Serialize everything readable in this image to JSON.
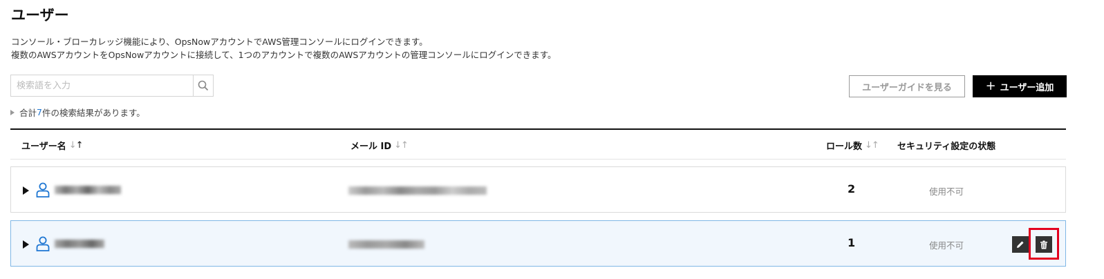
{
  "page": {
    "title": "ユーザー",
    "description": [
      "コンソール・ブローカレッジ機能により、OpsNowアカウントでAWS管理コンソールにログインできます。",
      "複数のAWSアカウントをOpsNowアカウントに接続して、1つのアカウントで複数のAWSアカウントの管理コンソールにログインできます。"
    ]
  },
  "search": {
    "placeholder": "検索語を入力",
    "value": ""
  },
  "summary": {
    "prefix": "合計",
    "count": "7",
    "suffix": "件の検索結果があります。"
  },
  "buttons": {
    "guide": "ユーザーガイドを見る",
    "add": "ユーザー追加"
  },
  "table": {
    "columns": {
      "username": "ユーザー名",
      "email": "メール ID",
      "roles": "ロール数",
      "security": "セキュリティ設定の状態"
    },
    "rows": [
      {
        "roles": "2",
        "security": "使用不可"
      },
      {
        "roles": "1",
        "security": "使用不可"
      }
    ]
  },
  "colors": {
    "accent": "#1e76d2",
    "highlight": "#e3001f",
    "selected_row": "#f1f7fd"
  }
}
